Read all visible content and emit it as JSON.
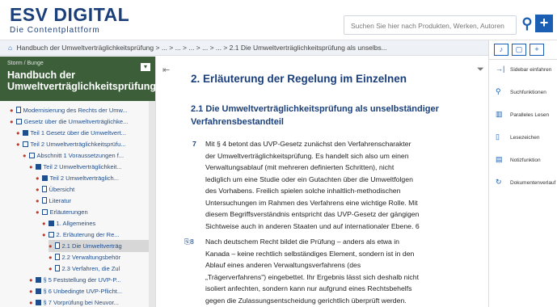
{
  "header": {
    "logo_top": "ESV DIGITAL",
    "logo_bottom": "Die Contentplattform",
    "search_placeholder": "Suchen Sie hier nach Produkten, Werken, Autoren",
    "search_icon": "search-icon",
    "plus_icon": "plus-icon"
  },
  "breadcrumb": "Handbuch der Umweltverträglichkeitsprüfung > ... > ... > ... > ... > ... > 2.1 Die Umweltverträglichkeitsprüfung als unselbs...",
  "sidebar": {
    "small": "Storm / Bunge",
    "title": "Handbuch der Umweltverträglichkeitsprüfung",
    "items": [
      {
        "label": "Modernisierung des Rechts der Umw...",
        "icon": "doc",
        "indent": 1
      },
      {
        "label": "Gesetz über die Umweltverträglichke...",
        "icon": "box",
        "indent": 1
      },
      {
        "label": "Teil 1 Gesetz über die Umweltvert...",
        "icon": "fill",
        "indent": 2
      },
      {
        "label": "Teil 2 Umweltverträglichkeitsprüfu...",
        "icon": "box",
        "indent": 2
      },
      {
        "label": "Abschnitt 1 Voraussetzungen f...",
        "icon": "box",
        "indent": 3
      },
      {
        "label": "Teil 2 Umweltverträglichkeit...",
        "icon": "fill",
        "indent": 4
      },
      {
        "label": "Teil 2 Umweltverträglich...",
        "icon": "fill",
        "indent": 5
      },
      {
        "label": "Übersicht",
        "icon": "doc",
        "indent": 5
      },
      {
        "label": "Literatur",
        "icon": "doc",
        "indent": 5
      },
      {
        "label": "Erläuterungen",
        "icon": "box",
        "indent": 5
      },
      {
        "label": "1. Allgemeines",
        "icon": "fill",
        "indent": 6
      },
      {
        "label": "2. Erläuterung der Re...",
        "icon": "box",
        "indent": 6
      },
      {
        "label": "2.1 Die Umweltverträg",
        "icon": "doc",
        "indent": 7,
        "highlight": true
      },
      {
        "label": "2.2 Verwaltungsbehör",
        "icon": "doc",
        "indent": 7
      },
      {
        "label": "2.3 Verfahren, die Zul",
        "icon": "doc",
        "indent": 7
      },
      {
        "label": "§ 5 Feststellung der UVP-P...",
        "icon": "fill",
        "indent": 4
      },
      {
        "label": "§ 6 Unbedingte UVP-Pflicht...",
        "icon": "fill",
        "indent": 4
      },
      {
        "label": "§ 7 Vorprüfung bei Neuvor...",
        "icon": "fill",
        "indent": 4
      }
    ]
  },
  "main": {
    "h2": "2. Erläuterung der Regelung im Einzelnen",
    "h3": "2.1 Die Umweltverträglichkeitsprüfung als unselbständiger Verfahrensbestandteil",
    "p7_num": "7",
    "p7_lines": [
      "Mit § 4 betont das UVP-Gesetz zunächst den Verfahrenscharakter",
      "der Umweltverträglichkeitsprüfung. Es handelt sich also um einen",
      "Verwaltungsablauf (mit mehreren definierten Schritten), nicht",
      "lediglich um eine Studie oder ein Gutachten über die Umweltfolgen",
      "des Vorhabens. Freilich spielen solche inhaltlich-methodischen",
      "Untersuchungen im Rahmen des Verfahrens eine wichtige Rolle. Mit",
      "diesem Begriffsverständnis entspricht das UVP-Gesetz der gängigen",
      "Sichtweise auch in anderen Staaten und auf internationaler Ebene. 6"
    ],
    "p8_num": "8",
    "p8_lines": [
      "Nach deutschem Recht bildet die Prüfung – anders als etwa in",
      "Kanada – keine rechtlich selbständiges Element, sondern ist in den",
      "Ablauf eines anderen Verwaltungsverfahrens (des",
      "„Trägerverfahrens\") eingebettet. Ihr Ergebnis lässt sich deshalb nicht",
      "isoliert anfechten, sondern kann nur aufgrund eines Rechtsbehelfs",
      "gegen die Zulassungsentscheidung gerichtlich überprüft werden."
    ]
  },
  "right_panel": {
    "items": [
      {
        "label": "Sidebar einfahren",
        "icon": "sidebar-icon"
      },
      {
        "label": "Suchfunktionen",
        "icon": "search-icon"
      },
      {
        "label": "Paralleles Lesen",
        "icon": "columns-icon"
      },
      {
        "label": "Lesezeichen",
        "icon": "bookmark-icon"
      },
      {
        "label": "Notizfunktion",
        "icon": "note-icon"
      },
      {
        "label": "Dokumentenverlauf",
        "icon": "history-icon"
      }
    ]
  }
}
